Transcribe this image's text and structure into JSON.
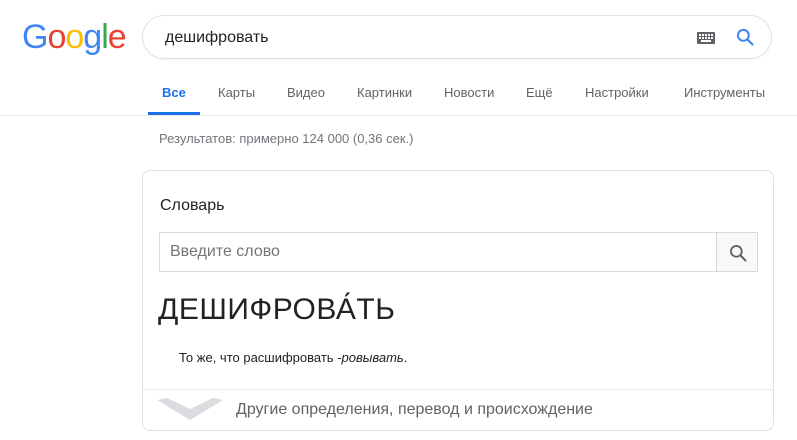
{
  "logo": {
    "letters": [
      "G",
      "o",
      "o",
      "g",
      "l",
      "e"
    ]
  },
  "search": {
    "query": "дешифровать"
  },
  "tabs": [
    {
      "label": "Все",
      "active": true
    },
    {
      "label": "Карты"
    },
    {
      "label": "Видео"
    },
    {
      "label": "Картинки"
    },
    {
      "label": "Новости"
    },
    {
      "label": "Ещё"
    },
    {
      "label": "Настройки"
    },
    {
      "label": "Инструменты"
    }
  ],
  "stats": "Результатов: примерно 124 000 (0,36 сек.)",
  "dictionary": {
    "title": "Словарь",
    "input_placeholder": "Введите слово",
    "headword": "ДЕШИФРОВА́ТЬ",
    "definition_prefix": "То же, что расшифровать ",
    "definition_italic": "-ровывать",
    "definition_suffix": ".",
    "footer": "Другие определения, перевод и происхождение"
  },
  "colors": {
    "accent": "#1a73e8",
    "logo_blue": "#4285f4",
    "logo_red": "#ea4335",
    "logo_yellow": "#fbbc05",
    "logo_green": "#34a853"
  },
  "icons": {
    "keyboard": "keyboard-icon",
    "search": "search-icon",
    "chevron": "chevron-down-icon"
  }
}
